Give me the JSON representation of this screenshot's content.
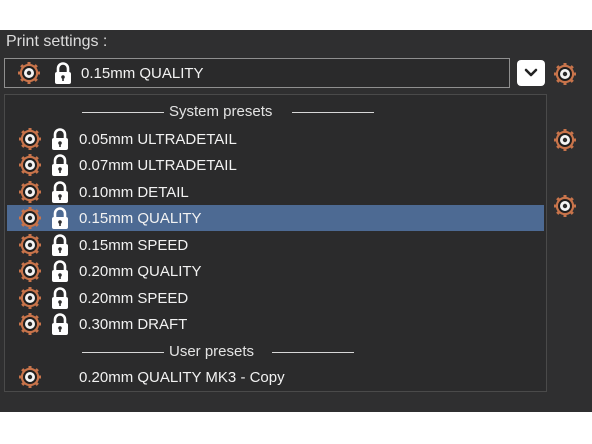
{
  "colors": {
    "panel_bg": "#2f2f30",
    "selected_row": "#4d6a93",
    "gear_icon": "#c8744b",
    "text": "#f2f2f2"
  },
  "print_settings": {
    "label": "Print settings :",
    "selected_value": "0.15mm QUALITY",
    "dropdown_icon": "chevron-down-icon"
  },
  "dropdown": {
    "system_header": "System presets",
    "user_header": "User presets",
    "system_presets": [
      {
        "label": "0.05mm ULTRADETAIL",
        "locked": true
      },
      {
        "label": "0.07mm ULTRADETAIL",
        "locked": true
      },
      {
        "label": "0.10mm DETAIL",
        "locked": true
      },
      {
        "label": "0.15mm QUALITY",
        "locked": true,
        "selected": true
      },
      {
        "label": "0.15mm SPEED",
        "locked": true
      },
      {
        "label": "0.20mm QUALITY",
        "locked": true
      },
      {
        "label": "0.20mm SPEED",
        "locked": true
      },
      {
        "label": "0.30mm DRAFT",
        "locked": true
      }
    ],
    "user_presets": [
      {
        "label": "0.20mm QUALITY MK3 - Copy",
        "locked": false
      }
    ]
  }
}
